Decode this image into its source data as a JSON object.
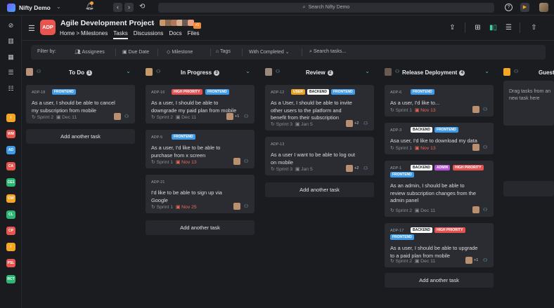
{
  "topbar": {
    "workspace": "Nifty Demo",
    "search_placeholder": "Search Nifty Demo",
    "back": "‹",
    "forward": "›",
    "help": "?",
    "play": "▶"
  },
  "sidebar": {
    "icons": [
      "compass-icon",
      "chart-icon",
      "calendar-icon",
      "list-icon",
      "checklist-icon"
    ],
    "projects": [
      {
        "label": "I",
        "color": "#f5a623"
      },
      {
        "label": "WM",
        "color": "#e8554e"
      },
      {
        "label": "AD",
        "color": "#3d9be9"
      },
      {
        "label": "CA",
        "color": "#e8554e"
      },
      {
        "label": "CE1",
        "color": "#2bb673"
      },
      {
        "label": "CW",
        "color": "#f5a623"
      },
      {
        "label": "CL",
        "color": "#2bb673"
      },
      {
        "label": "CP",
        "color": "#e8554e"
      },
      {
        "label": "I",
        "color": "#f5a623"
      },
      {
        "label": "PSL",
        "color": "#e8554e"
      },
      {
        "label": "RCT",
        "color": "#2bb673"
      }
    ]
  },
  "header": {
    "badge": "ADP",
    "title": "Agile Development Project",
    "member_count": "+1",
    "tabs": [
      "Home",
      "Milestones",
      "Tasks",
      "Discussions",
      "Docs",
      "Files"
    ],
    "active_tab": "Tasks",
    "home_sep": ">"
  },
  "filters": {
    "label": "Filter by:",
    "assignees": "Assignees",
    "due_date": "Due Date",
    "milestone": "Milestone",
    "tags": "Tags",
    "with_completed": "With Completed",
    "search_placeholder": "Search tasks..."
  },
  "add_task_label": "Add another task",
  "columns": [
    {
      "title": "To Do",
      "count": "1",
      "cards": [
        {
          "id": "ADP-18",
          "tags": [
            [
              "FRONTEND",
              "frontend"
            ]
          ],
          "text": [
            "As a user, I should be able to cancel",
            "my subscription from mobile"
          ],
          "sprint": "Sprint 2",
          "date": "Dec 11",
          "overdue": false,
          "plus": ""
        }
      ]
    },
    {
      "title": "In Progress",
      "count": "3",
      "cards": [
        {
          "id": "ADP-16",
          "tags": [
            [
              "HIGH PRIORITY",
              "high"
            ],
            [
              "FRONTEND",
              "frontend"
            ]
          ],
          "text": [
            "As a user, I should be able to",
            "downgrade my paid plan from mobile"
          ],
          "sprint": "Sprint 2",
          "date": "Dec 11",
          "overdue": false,
          "plus": "+1"
        },
        {
          "id": "ADP-5",
          "tags": [
            [
              "FRONTEND",
              "frontend"
            ]
          ],
          "text": [
            "As a user, I'd like to be able to",
            "purchase from x screen"
          ],
          "sprint": "Sprint 1",
          "date": "Nov 13",
          "overdue": true,
          "plus": ""
        },
        {
          "id": "ADP-21",
          "tags": [],
          "text": [
            "I'd like to be able to sign up via",
            "Google"
          ],
          "sprint": "Sprint 1",
          "date": "Nov 25",
          "overdue": true,
          "plus": ""
        }
      ]
    },
    {
      "title": "Review",
      "count": "2",
      "cards": [
        {
          "id": "ADP-12",
          "tags": [
            [
              "USER",
              "user"
            ],
            [
              "BACKEND",
              "backend"
            ],
            [
              "FRONTEND",
              "frontend"
            ]
          ],
          "text": [
            "As a User, I should be able to invite",
            "other users to the platform and",
            "benefit from their subscription"
          ],
          "sprint": "Sprint 3",
          "date": "Jan 5",
          "overdue": false,
          "plus": "+2"
        },
        {
          "id": "ADP-13",
          "tags": [],
          "text": [
            "As a user I want to be able to log out",
            "on mobile"
          ],
          "sprint": "Sprint 3",
          "date": "Jan 5",
          "overdue": false,
          "plus": "+2"
        }
      ]
    },
    {
      "title": "Release Deployment",
      "count": "4",
      "cards": [
        {
          "id": "ADP-6",
          "tags": [
            [
              "FRONTEND",
              "frontend"
            ]
          ],
          "text": [
            "As a user, I'd like to..."
          ],
          "sprint": "Sprint 1",
          "date": "Nov 13",
          "overdue": true,
          "plus": ""
        },
        {
          "id": "ADP-3",
          "tags": [
            [
              "BACKEND",
              "backend"
            ],
            [
              "FRONTEND",
              "frontend"
            ]
          ],
          "text": [
            "Asa user, I'd like to download my data"
          ],
          "sprint": "Sprint 1",
          "date": "Nov 13",
          "overdue": true,
          "plus": ""
        },
        {
          "id": "ADP-1",
          "tags": [
            [
              "BACKEND",
              "backend"
            ],
            [
              "ADMIN",
              "admin"
            ],
            [
              "HIGH PRIORITY",
              "high"
            ],
            [
              "FRONTEND",
              "frontend"
            ]
          ],
          "text": [
            "As an admin, I should be able to",
            "review subscription changes from the",
            "admin panel"
          ],
          "sprint": "Sprint 2",
          "date": "Dec 11",
          "overdue": false,
          "plus": ""
        },
        {
          "id": "ADP-17",
          "tags": [
            [
              "BACKEND",
              "backend"
            ],
            [
              "HIGH PRIORITY",
              "high"
            ],
            [
              "FRONTEND",
              "frontend"
            ]
          ],
          "text": [
            "As a user, I should be able to upgrade",
            "to a paid plan from mobile"
          ],
          "sprint": "Sprint 2",
          "date": "Dec 11",
          "overdue": false,
          "plus": "+1"
        }
      ]
    }
  ],
  "guest_column": {
    "title": "Guest",
    "text": [
      "Drag tasks from an",
      "new task here"
    ]
  }
}
